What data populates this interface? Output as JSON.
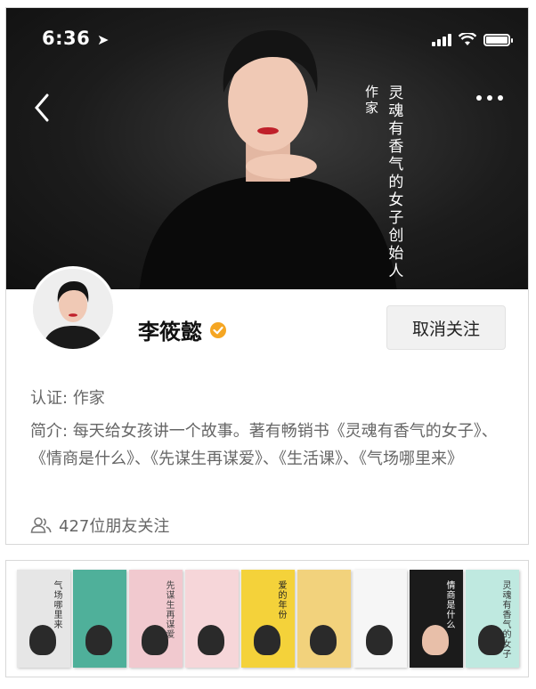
{
  "status_bar": {
    "time": "6:36",
    "location_icon": "location-arrow-icon"
  },
  "header": {
    "back_icon": "chevron-left-icon",
    "more_icon": "more-dots-icon",
    "cover_title": "灵魂有香气的女子创始人",
    "cover_subtitle": "作家"
  },
  "profile": {
    "name": "李筱懿",
    "verified_color": "#f5a623",
    "follow_button_label": "取消关注",
    "certification": "认证: 作家",
    "bio": "简介: 每天给女孩讲一个故事。著有畅销书《灵魂有香气的女子》、《情商是什么》、《先谋生再谋爱》、《生活课》、《气场哪里来》",
    "friends_following": "427位朋友关注"
  },
  "books": [
    {
      "title": "气场哪里来",
      "bg": "#e6e6e6",
      "fg": "#333333"
    },
    {
      "title": "",
      "bg": "#4fb09a",
      "fg": "#ffffff"
    },
    {
      "title": "先谋生再谋爱",
      "bg": "#f1c9cf",
      "fg": "#444444"
    },
    {
      "title": "",
      "bg": "#f6d6d9",
      "fg": "#444444"
    },
    {
      "title": "爱的年份",
      "bg": "#f4d23a",
      "fg": "#222222"
    },
    {
      "title": "",
      "bg": "#f2d27c",
      "fg": "#444444"
    },
    {
      "title": "",
      "bg": "#f6f6f6",
      "fg": "#333333"
    },
    {
      "title": "情商是什么",
      "bg": "#1b1b1b",
      "fg": "#ffffff"
    },
    {
      "title": "灵魂有香气的女子",
      "bg": "#bfe9e0",
      "fg": "#333333"
    }
  ]
}
